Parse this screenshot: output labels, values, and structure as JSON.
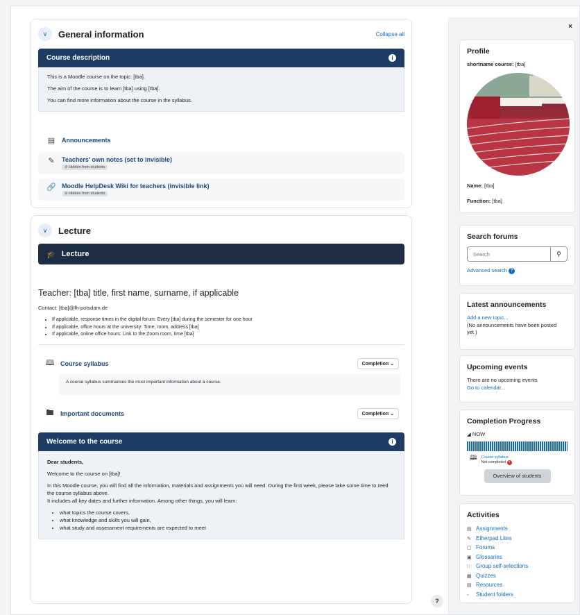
{
  "general": {
    "title": "General information",
    "collapse_all": "Collapse all",
    "description_header": "Course description",
    "description_lines": [
      "This is a Moodle course on the topic: [tba].",
      "The aim of the course is to learn [tba] using [tba].",
      "You can find more information about the course in the syllabus."
    ],
    "announcements": "Announcements",
    "teacher_notes": "Teachers' own notes (set to invisible)",
    "helpdesk": "Moodle HelpDesk Wiki for teachers (invisible link)",
    "hidden_badge": "Hidden from students"
  },
  "lecture": {
    "title": "Lecture",
    "banner": "Lecture",
    "teacher_line": "Teacher: [tba] title, first name, surname, if applicable",
    "contact": "Contact: [tba]@fh-potsdam.de",
    "bullets": [
      "If applicable, response times in the digital forum: Every [tba] during the semester for one hour",
      "If applicable, office hours at the university: Time, room, address [tba]",
      "If applicable, online office hours: Link to the Zoom room, time [tba]"
    ],
    "syllabus": "Course syllabus",
    "syllabus_desc": "A course syllabus summarises the most important information about a course.",
    "documents": "Important documents",
    "completion": "Completion",
    "welcome_header": "Welcome to the course",
    "welcome_greeting": "Dear students,",
    "welcome_intro": "Welcome to the course on [tba]!",
    "welcome_p1": "In this Moodle course, you will find all the information, materials and assignments you will need. During the first week, please take some time to reed the course syllabus above.",
    "welcome_p2": "It includes all key dates and further information. Among other things, you will learn:",
    "welcome_bullets": [
      "what topics the course covers,",
      "what knowledge and skills you will gain,",
      "what study and assessment requirements are expected to meet"
    ]
  },
  "drawer": {
    "close": "×",
    "profile": {
      "title": "Profile",
      "shortname_label": "shortname course:",
      "shortname_value": "[tba]",
      "name_label": "Name:",
      "name_value": "[tba]",
      "function_label": "Function:",
      "function_value": "[tba]"
    },
    "search": {
      "title": "Search forums",
      "placeholder": "Search",
      "advanced": "Advanced search"
    },
    "announcements": {
      "title": "Latest announcements",
      "add": "Add a new topic...",
      "none": "(No announcements have been posted yet.)"
    },
    "events": {
      "title": "Upcoming events",
      "none": "There are no upcoming events",
      "goto": "Go to calendar..."
    },
    "progress": {
      "title": "Completion Progress",
      "now": "NOW",
      "item": "Course syllabus",
      "status": "Not completed",
      "overview": "Overview of students"
    },
    "activities": {
      "title": "Activities",
      "items": [
        "Assignments",
        "Etherpad Lites",
        "Forums",
        "Glossaries",
        "Group self-selections",
        "Quizzes",
        "Resources",
        "Student folders"
      ]
    }
  },
  "help": "?"
}
